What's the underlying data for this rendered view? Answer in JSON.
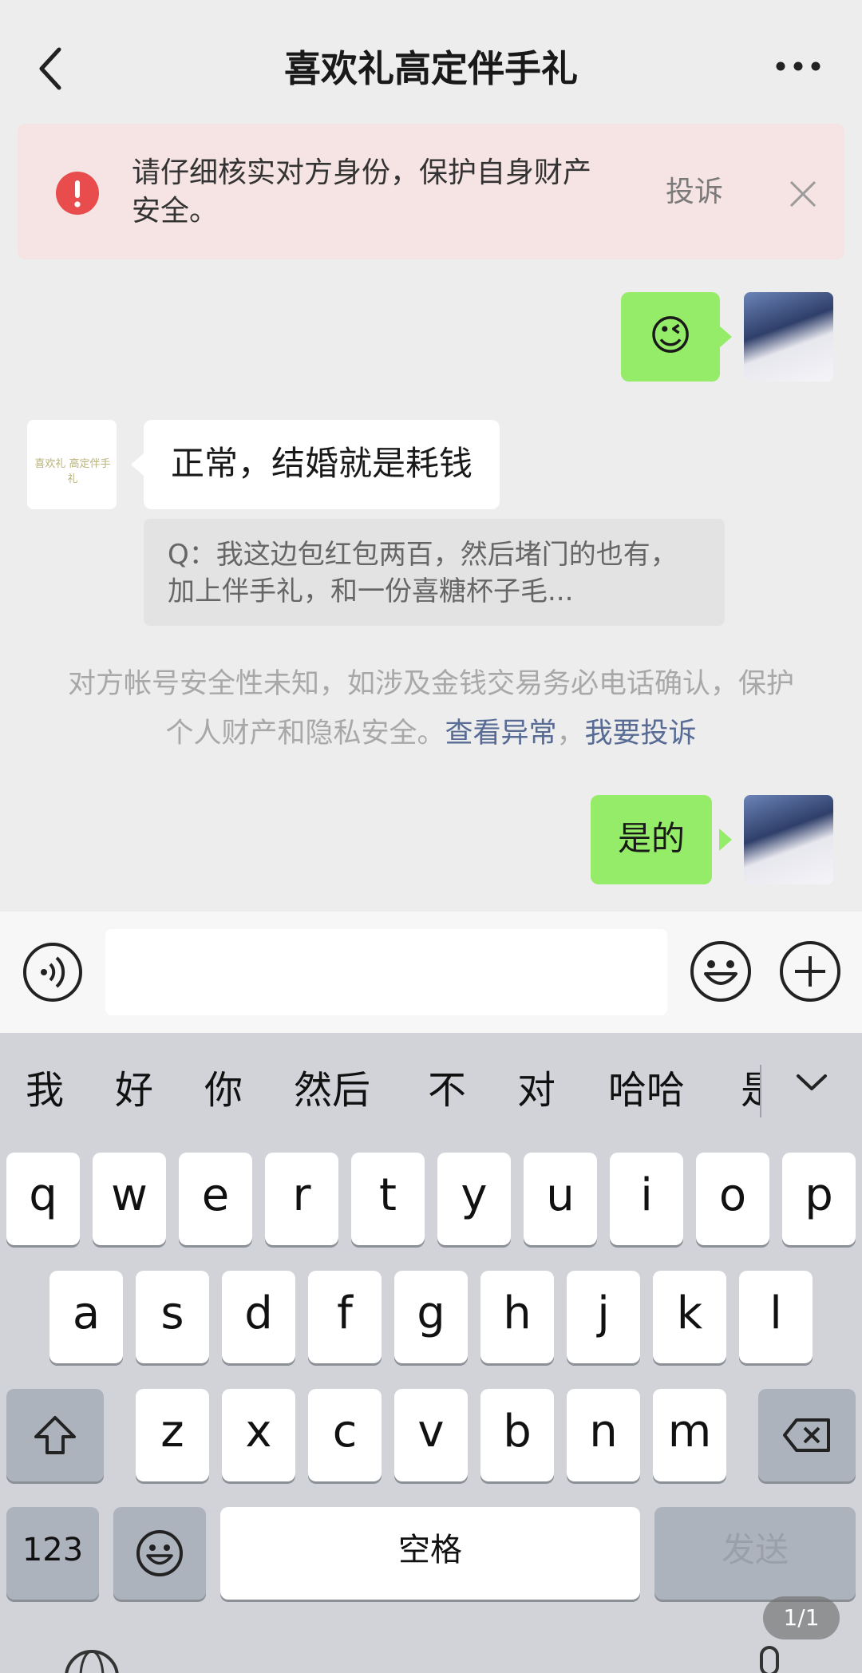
{
  "header": {
    "title": "喜欢礼高定伴手礼"
  },
  "banner": {
    "text": "请仔细核实对方身份，保护自身财产安全。",
    "complain_label": "投诉"
  },
  "messages": {
    "m1_emoji": "😉",
    "m2_text": "正常，结婚就是耗钱",
    "m2_avatar_text": "喜欢礼 高定伴手礼",
    "quote_text": "Q：我这边包红包两百，然后堵门的也有，加上伴手礼，和一份喜糖杯子毛...",
    "m3_text": "是的"
  },
  "notice": {
    "text": "对方帐号安全性未知，如涉及金钱交易务必电话确认，保护个人财产和隐私安全。",
    "link_view": "查看异常",
    "sep": "，",
    "link_complain": "我要投诉"
  },
  "input": {
    "value": ""
  },
  "keyboard": {
    "candidates": [
      "我",
      "好",
      "你",
      "然后",
      "不",
      "对",
      "哈哈",
      "是"
    ],
    "row1": [
      "q",
      "w",
      "e",
      "r",
      "t",
      "y",
      "u",
      "i",
      "o",
      "p"
    ],
    "row2": [
      "a",
      "s",
      "d",
      "f",
      "g",
      "h",
      "j",
      "k",
      "l"
    ],
    "row3": [
      "z",
      "x",
      "c",
      "v",
      "b",
      "n",
      "m"
    ],
    "num_label": "123",
    "space_label": "空格",
    "send_label": "发送"
  },
  "page_indicator": "1/1",
  "colors": {
    "accent_green": "#95ec69",
    "link": "#576b95",
    "alert_red": "#e84c4c",
    "banner_bg": "#f6e4e4"
  }
}
